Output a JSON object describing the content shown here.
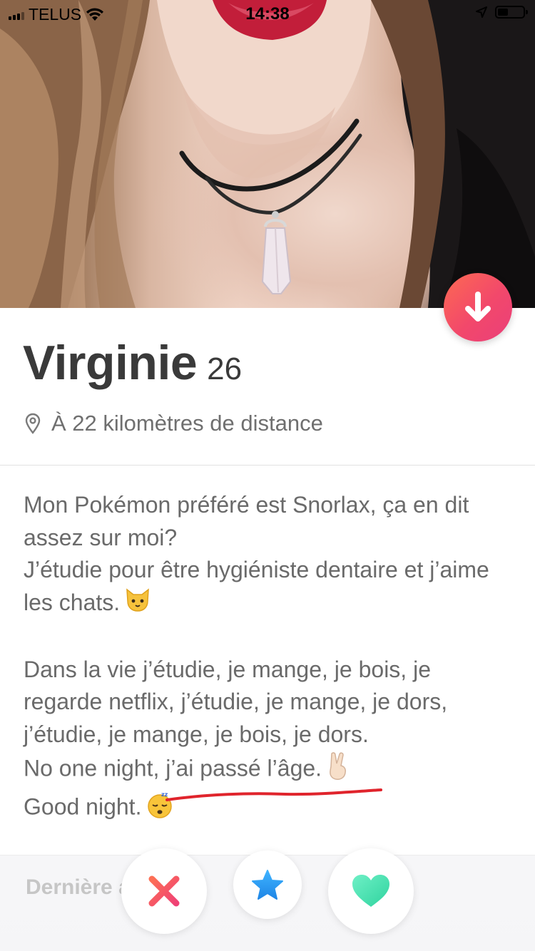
{
  "status_bar": {
    "carrier": "TELUS",
    "time": "14:38"
  },
  "profile": {
    "name": "Virginie",
    "age": "26",
    "distance": "À 22 kilomètres de distance",
    "bio_paragraphs": [
      "Mon Pokémon préféré est Snorlax, ça en dit assez sur moi?",
      "J’étudie pour être hygiéniste dentaire et j’aime les chats.",
      "Dans la vie j’étudie, je mange, je bois, je regarde netflix, j’étudie, je mange, je dors, j’étudie, je mange, je bois, je dors.",
      "No one night, j’ai passé l’âge.",
      "Good night."
    ],
    "bio_emojis": [
      "cat-face-emoji",
      "victory-hand-emoji",
      "sleepy-face-emoji"
    ],
    "last_active_partial": "Dernière activité"
  },
  "colors": {
    "accent_gradient_start": "#fd6a52",
    "accent_gradient_end": "#ea3f7a",
    "nope_color": "#f2576c",
    "superlike_color": "#2e9bff",
    "like_color": "#48e0b0",
    "annotation_red": "#e0242c"
  },
  "icons": {
    "collapse": "arrow-down-icon",
    "location": "location-pin-icon",
    "nope": "x-icon",
    "superlike": "star-icon",
    "like": "heart-icon"
  }
}
